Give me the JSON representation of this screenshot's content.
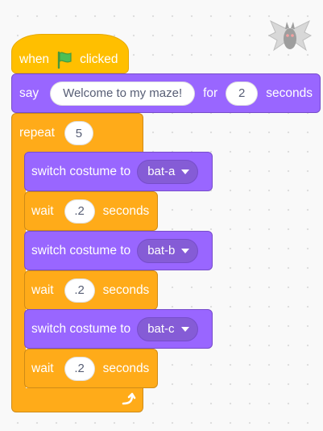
{
  "script": {
    "hat": {
      "before": "when",
      "after": "clicked",
      "icon": "green-flag-icon",
      "color": "#ffbf00"
    },
    "say": {
      "label": "say",
      "message": "Welcome to my maze!",
      "for_label": "for",
      "duration": "2",
      "unit": "seconds",
      "color": "#9966ff"
    },
    "repeat": {
      "label": "repeat",
      "count": "5",
      "loop_icon": "loop-arrow-icon",
      "color": "#ffab19"
    },
    "steps": [
      {
        "switch_label": "switch costume to",
        "costume": "bat-a",
        "wait_label": "wait",
        "wait_value": ".2",
        "wait_unit": "seconds"
      },
      {
        "switch_label": "switch costume to",
        "costume": "bat-b",
        "wait_label": "wait",
        "wait_value": ".2",
        "wait_unit": "seconds"
      },
      {
        "switch_label": "switch costume to",
        "costume": "bat-c",
        "wait_label": "wait",
        "wait_value": ".2",
        "wait_unit": "seconds"
      }
    ]
  },
  "sprite": {
    "icon": "bat-sprite-icon"
  }
}
